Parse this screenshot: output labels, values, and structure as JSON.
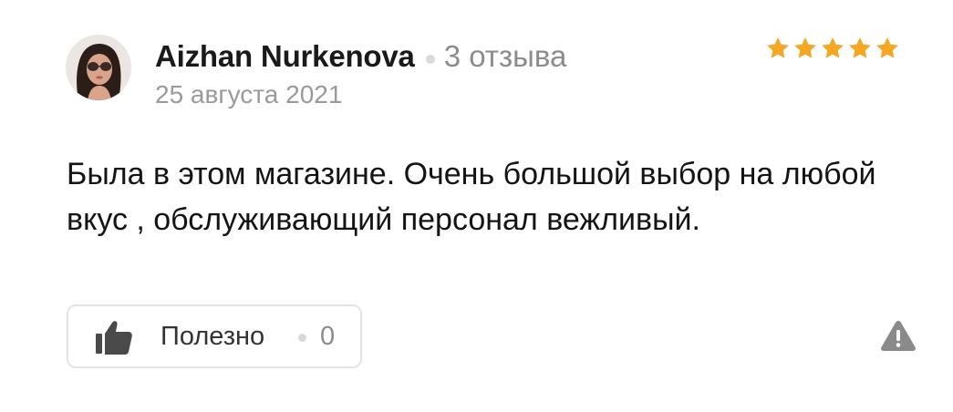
{
  "review": {
    "author": {
      "name": "Aizhan Nurkenova",
      "reviews_count": "3 отзыва",
      "avatar_icon": "user-photo"
    },
    "date": "25 августа 2021",
    "rating": 5,
    "rating_max": 5,
    "star_color": "#f5a623",
    "text": "Была в этом магазине. Очень большой выбор на любой вкус , обслуживающий персонал вежливый.",
    "useful": {
      "label": "Полезно",
      "count": "0",
      "icon": "thumbs-up-icon"
    },
    "report_icon": "warning-icon"
  }
}
